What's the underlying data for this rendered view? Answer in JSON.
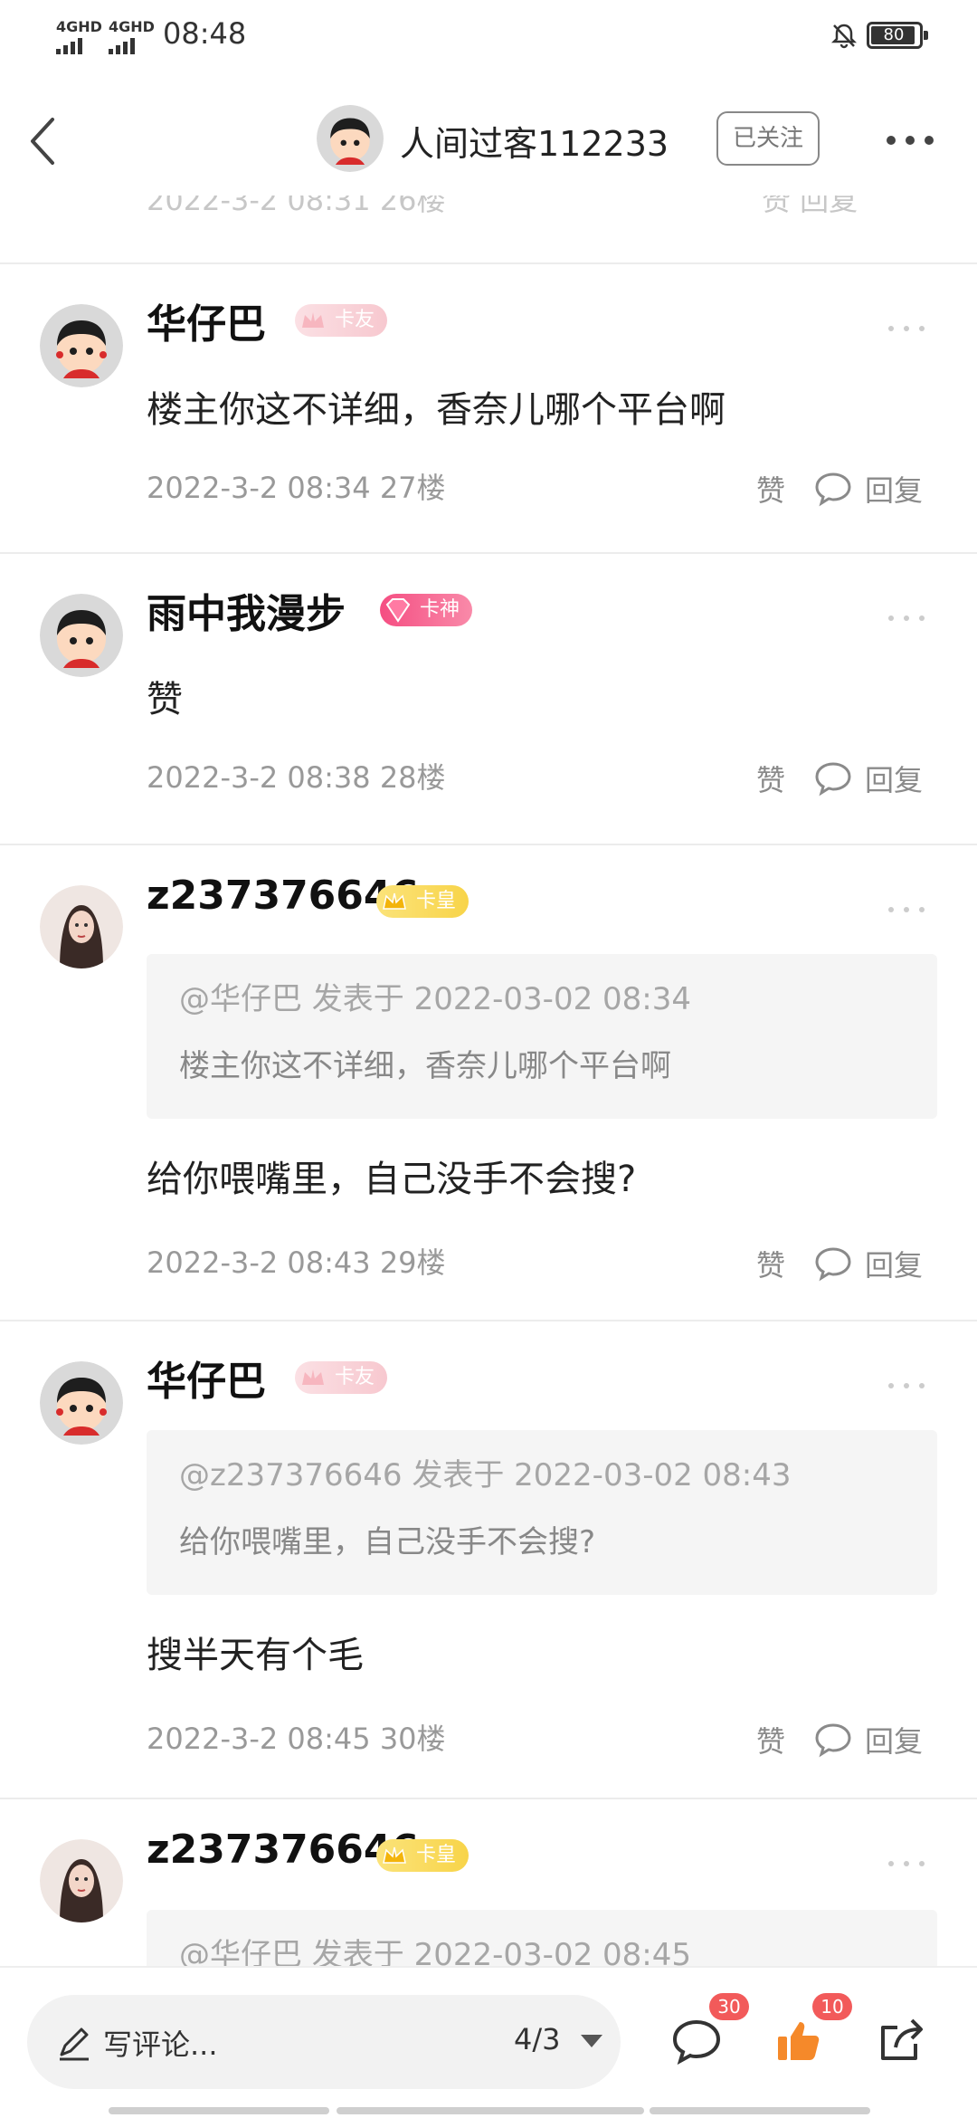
{
  "status_bar": {
    "net1": "4GHD",
    "net2": "4GHD",
    "time": "08:48",
    "battery": "80"
  },
  "header": {
    "title": "人间过客112233",
    "follow_label": "已关注"
  },
  "partial_row": {
    "time_floor": "2022-3-2 08:31 26楼",
    "actions": "赞 回复"
  },
  "actions": {
    "like": "赞",
    "reply": "回复"
  },
  "comments": [
    {
      "user": "华仔巴",
      "badge": "卡友",
      "text": "楼主你这不详细，香奈儿哪个平台啊",
      "time": "2022-3-2 08:34",
      "floor": "27楼"
    },
    {
      "user": "雨中我漫步",
      "badge": "卡神",
      "text": "赞",
      "time": "2022-3-2 08:38",
      "floor": "28楼"
    },
    {
      "user": "z237376646",
      "badge": "卡皇",
      "quote_header": "@华仔巴 发表于 2022-03-02 08:34",
      "quote_text": "楼主你这不详细，香奈儿哪个平台啊",
      "text": "给你喂嘴里，自己没手不会搜?",
      "time": "2022-3-2 08:43",
      "floor": "29楼"
    },
    {
      "user": "华仔巴",
      "badge": "卡友",
      "quote_header": "@z237376646 发表于 2022-03-02 08:43",
      "quote_text": "给你喂嘴里，自己没手不会搜?",
      "text": "搜半天有个毛",
      "time": "2022-3-2 08:45",
      "floor": "30楼"
    },
    {
      "user": "z237376646",
      "badge": "卡皇",
      "quote_header": "@华仔巴 发表于 2022-03-02 08:45"
    }
  ],
  "bottom_bar": {
    "placeholder": "写评论...",
    "pager": "4/3",
    "comment_count": "30",
    "like_count": "10"
  },
  "colors": {
    "accent_orange": "#f5892a",
    "badge_red": "#f25a5a"
  },
  "icons": [
    "back-icon",
    "bell-off-icon",
    "more-icon",
    "comment-icon",
    "pen-icon",
    "thumbs-up-icon",
    "share-icon"
  ]
}
